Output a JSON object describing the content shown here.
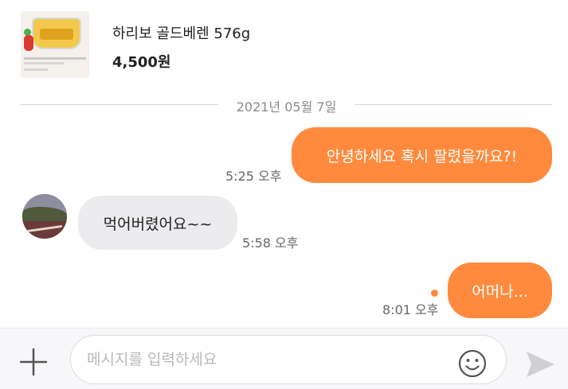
{
  "product": {
    "title": "하리보 골드베렌 576g",
    "price": "4,500원"
  },
  "chat": {
    "date": "2021년 05월 7일",
    "messages": [
      {
        "sender": "me",
        "text": "안녕하세요 혹시 팔렸을까요?!",
        "time": "5:25 오후"
      },
      {
        "sender": "them",
        "text": "먹어버렸어요~~",
        "time": "5:58 오후"
      },
      {
        "sender": "me",
        "text": "어머나...",
        "time": "8:01 오후",
        "unread": true
      }
    ]
  },
  "composer": {
    "placeholder": "메시지를 입력하세요",
    "value": ""
  },
  "icons": {
    "attach": "plus-icon",
    "emoji": "smiley-icon",
    "send": "send-icon"
  },
  "colors": {
    "accent": "#ff8a3d",
    "other_bubble": "#ececef",
    "send_disabled": "#d0d0d4"
  }
}
